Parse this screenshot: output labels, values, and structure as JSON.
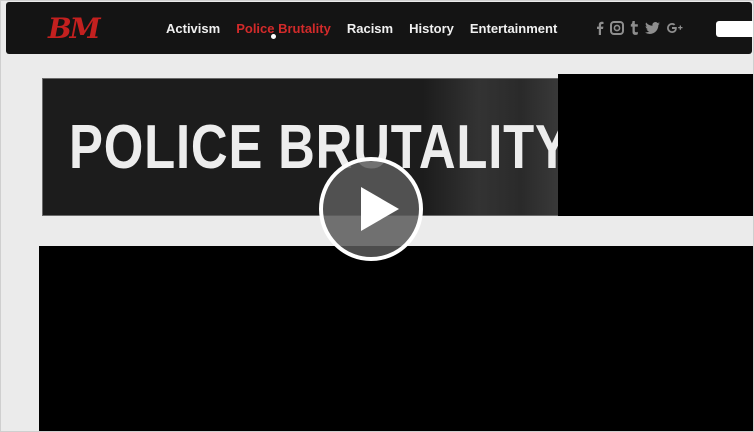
{
  "header": {
    "logo_text": "BM",
    "nav": [
      {
        "label": "Activism",
        "active": false
      },
      {
        "label": "Police Brutality",
        "active": true
      },
      {
        "label": "Racism",
        "active": false
      },
      {
        "label": "History",
        "active": false
      },
      {
        "label": "Entertainment",
        "active": false
      }
    ],
    "social": [
      {
        "icon": "facebook-icon",
        "glyph": "f"
      },
      {
        "icon": "instagram-icon",
        "glyph": "◙"
      },
      {
        "icon": "tumblr-icon",
        "glyph": "t"
      },
      {
        "icon": "twitter-icon",
        "glyph": "🐦"
      },
      {
        "icon": "google-plus-icon",
        "glyph": "G+"
      }
    ]
  },
  "banner": {
    "title": "POLICE BRUTALITY"
  },
  "video": {
    "play_icon": "play-icon"
  },
  "colors": {
    "navbar": "#141414",
    "brand_red": "#c3201f",
    "active_link": "#d22a2a",
    "page_bg": "#ebebeb"
  }
}
